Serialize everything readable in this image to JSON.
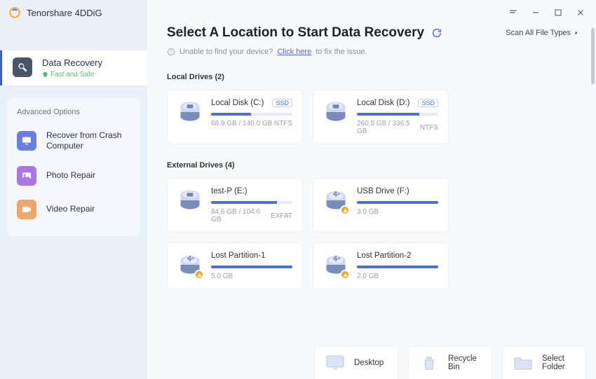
{
  "app": {
    "title": "Tenorshare 4DDiG"
  },
  "sidebar": {
    "main": {
      "label": "Data Recovery",
      "sub": "Fast and Safe"
    },
    "advanced_title": "Advanced Options",
    "items": [
      {
        "label": "Recover from Crash Computer"
      },
      {
        "label": "Photo Repair"
      },
      {
        "label": "Video Repair"
      }
    ]
  },
  "header": {
    "title": "Select A Location to Start Data Recovery",
    "scan_types": "Scan All File Types",
    "help_prefix": "Unable to find your device?",
    "help_link": "Click here",
    "help_suffix": "to fix the issue."
  },
  "sections": {
    "local": {
      "title": "Local Drives (2)"
    },
    "external": {
      "title": "External Drives (4)"
    }
  },
  "local_drives": [
    {
      "name": "Local Disk (C:)",
      "badge": "SSD",
      "size": "68.9 GB / 140.0 GB",
      "fs": "NTFS",
      "fill": 49
    },
    {
      "name": "Local Disk (D:)",
      "badge": "SSD",
      "size": "260.5 GB / 336.5 GB",
      "fs": "NTFS",
      "fill": 77
    }
  ],
  "external_drives": [
    {
      "name": "test-P (E:)",
      "size": "84.6 GB / 104.6 GB",
      "fs": "EXFAT",
      "fill": 81,
      "icon": "hdd"
    },
    {
      "name": "USB Drive (F:)",
      "size": "3.0 GB",
      "fs": "",
      "fill": 100,
      "icon": "usb",
      "warn": true
    },
    {
      "name": "Lost Partition-1",
      "size": "5.0 GB",
      "fs": "",
      "fill": 100,
      "icon": "usb",
      "warn": true
    },
    {
      "name": "Lost Partition-2",
      "size": "2.0 GB",
      "fs": "",
      "fill": 100,
      "icon": "usb",
      "warn": true
    }
  ],
  "common": [
    {
      "label": "Desktop"
    },
    {
      "label": "Recycle Bin"
    },
    {
      "label": "Select Folder"
    }
  ]
}
